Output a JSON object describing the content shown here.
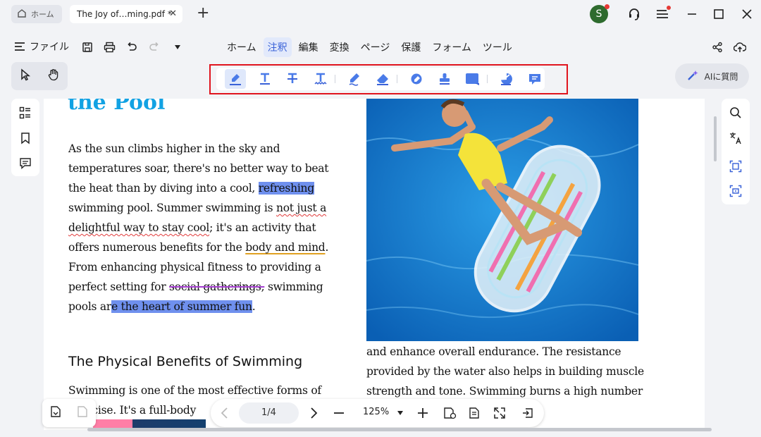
{
  "titlebar": {
    "home_tab_label": "ホーム",
    "doc_tab_label": "The Joy of…ming.pdf *",
    "close_glyph": "✕",
    "new_tab_glyph": "+",
    "avatar_initial": "S"
  },
  "menu": {
    "file_label": "ファイル",
    "tabs": [
      "ホーム",
      "注釈",
      "編集",
      "変換",
      "ページ",
      "保護",
      "フォーム",
      "ツール"
    ],
    "active_tab": "注釈"
  },
  "ai_button_label": "AIに質問",
  "document": {
    "heading_fragment": "the Pool",
    "paragraph": {
      "t1": "As the sun climbs higher in the sky and temperatures soar, there's no better way to beat the heat than by diving into a cool, ",
      "hl1": "refreshing",
      "t2": " swimming pool. Summer swimming is ",
      "sq": "not just a delightful way to stay cool",
      "t3": "; it's an activity that offers numerous benefits for the ",
      "ul": "body and mind",
      "t4": ". From enhancing physical fitness to providing a perfect setting for ",
      "st": "social gatherings,",
      "t5": " swimming pools ar",
      "hl2": "e the heart of summer fun",
      "t6": "."
    },
    "subheading": "The Physical Benefits of Swimming",
    "paragraph2": "Swimming is one of the most effective forms of exercise. It's a full-body",
    "right_column": "and enhance overall endurance. The resistance provided by the water also helps in building muscle strength and tone. Swimming burns a high number"
  },
  "bottom": {
    "page_indicator": "1/4",
    "zoom": "125%"
  },
  "colors": {
    "accent": "#3a62d8",
    "highlight": "#6f90ee",
    "annotation_box": "#e0141e",
    "heading_blue": "#12a2e3"
  }
}
